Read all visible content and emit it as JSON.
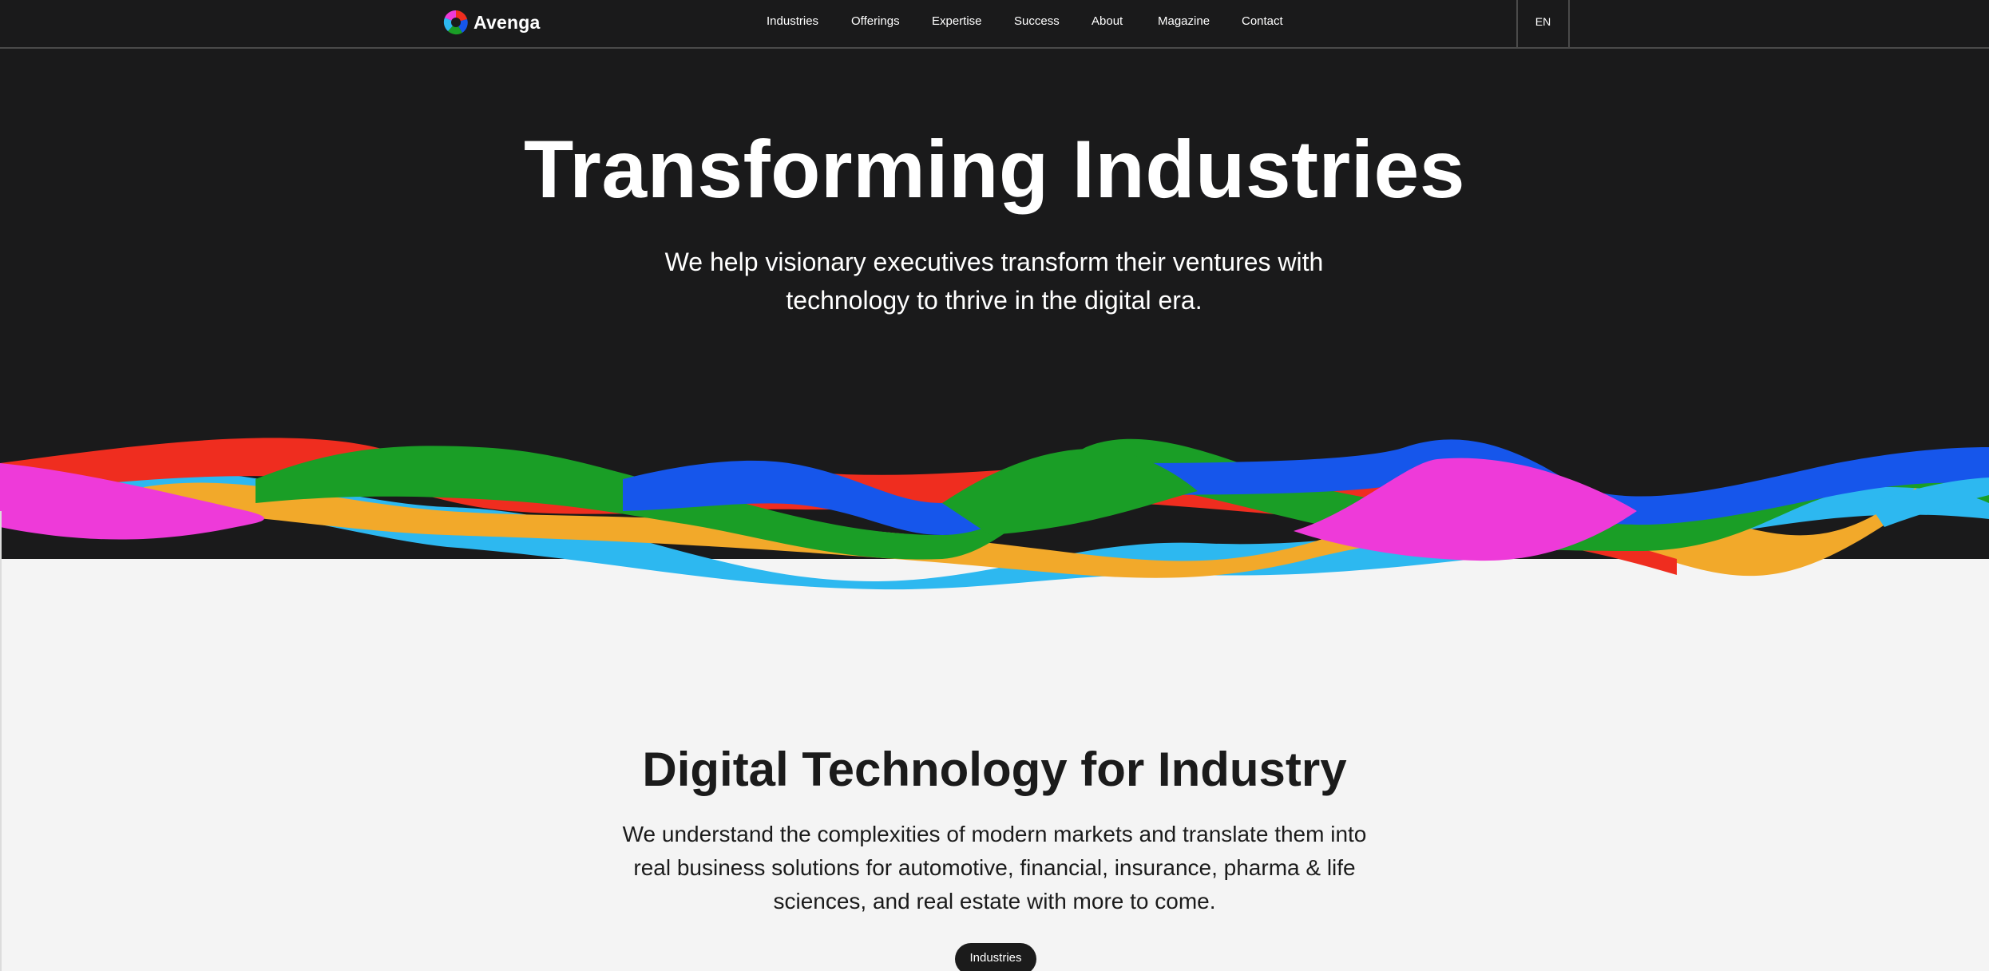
{
  "brand": {
    "name": "Avenga",
    "logo_icon": "avenga-logo-icon"
  },
  "nav": {
    "items": [
      {
        "label": "Industries"
      },
      {
        "label": "Offerings"
      },
      {
        "label": "Expertise"
      },
      {
        "label": "Success"
      },
      {
        "label": "About"
      },
      {
        "label": "Magazine"
      },
      {
        "label": "Contact"
      }
    ],
    "language": "EN"
  },
  "hero": {
    "title": "Transforming Industries",
    "subtitle": "We help visionary executives transform their ventures with technology to thrive in the digital era."
  },
  "section": {
    "title": "Digital Technology for Industry",
    "body": "We understand the complexities of modern markets and translate them into real business solutions for automotive, financial, insurance, pharma & life sciences, and real estate with more to come.",
    "cta_label": "Industries"
  },
  "colors": {
    "dark_background": "#1a1a1b",
    "light_background": "#f4f4f4",
    "wave_red": "#ef2d1f",
    "wave_green": "#1a9e26",
    "wave_blue": "#1656eb",
    "wave_cyan": "#2db8f0",
    "wave_orange": "#f2a92a",
    "wave_magenta": "#ee3ad9"
  }
}
